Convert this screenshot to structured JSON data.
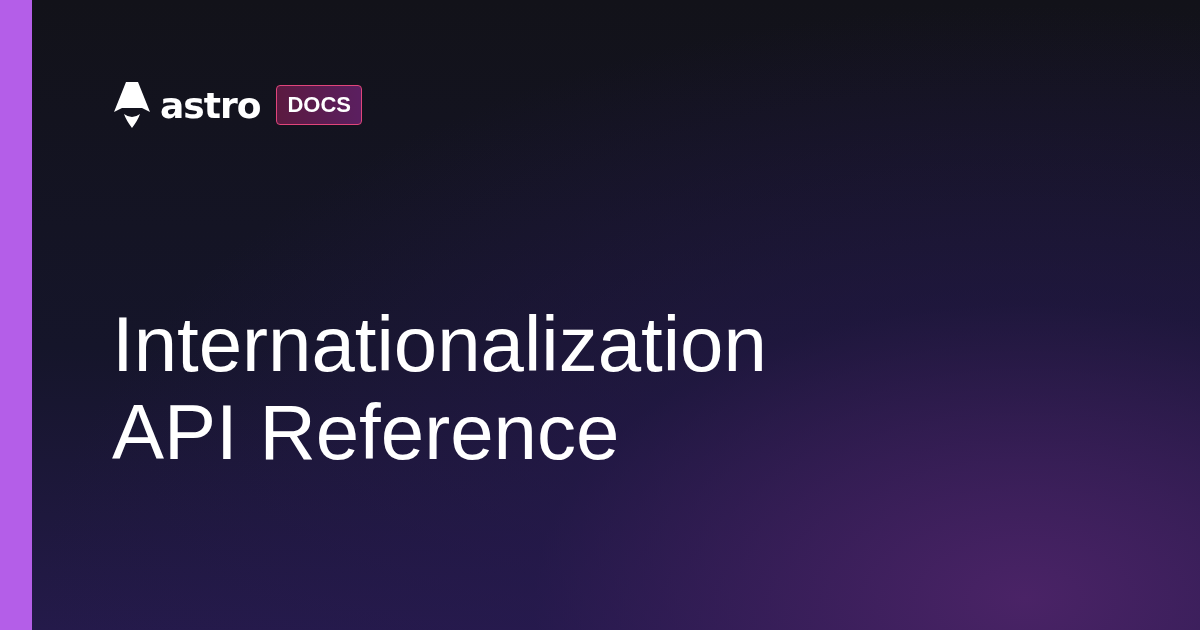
{
  "brand": {
    "wordmark": "astro",
    "badge": "DOCS"
  },
  "title": {
    "lines": [
      "Internationalization",
      "API Reference"
    ]
  }
}
